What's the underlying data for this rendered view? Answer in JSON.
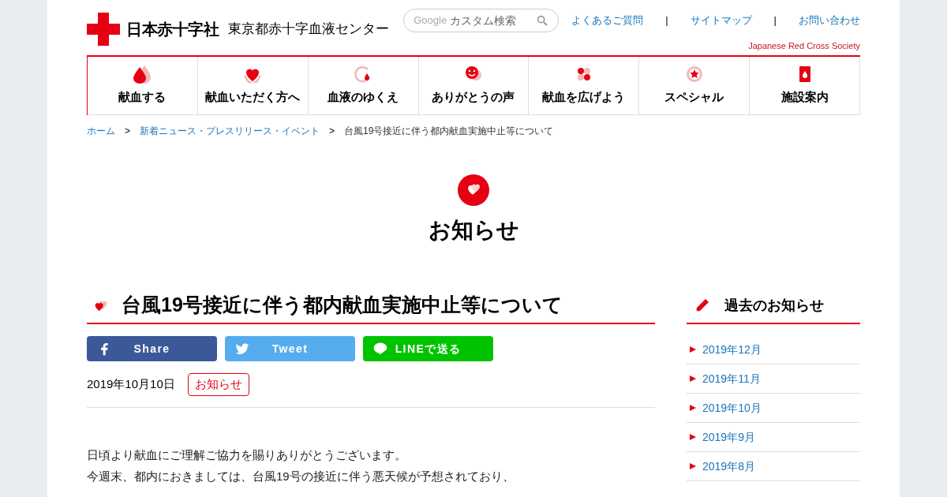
{
  "header": {
    "logo": "日本赤十字社",
    "center_name": "東京都赤十字血液センター",
    "search": {
      "brand": "Google",
      "placeholder": "カスタム検索"
    },
    "links": [
      "よくあるご質問",
      "サイトマップ",
      "お問い合わせ"
    ],
    "separators": [
      "|",
      "|"
    ],
    "tagline": "Japanese Red Cross Society"
  },
  "nav": [
    {
      "label": "献血する"
    },
    {
      "label": "献血いただく方へ"
    },
    {
      "label": "血液のゆくえ"
    },
    {
      "label": "ありがとうの声"
    },
    {
      "label": "献血を広げよう"
    },
    {
      "label": "スペシャル"
    },
    {
      "label": "施設案内"
    }
  ],
  "breadcrumb": [
    {
      "label": "ホーム",
      "kind": "link"
    },
    {
      "label": "新着ニュース・プレスリリース・イベント",
      "kind": "link"
    },
    {
      "label": "台風19号接近に伴う都内献血実施中止等について",
      "kind": "current"
    }
  ],
  "breadcrumb_separators": [
    ">",
    ">"
  ],
  "page_title": "お知らせ",
  "article": {
    "title": "台風19号接近に伴う都内献血実施中止等について",
    "share": [
      {
        "kind": "facebook",
        "label": "Share"
      },
      {
        "kind": "twitter",
        "label": "Tweet"
      },
      {
        "kind": "line",
        "label": "LINEで送る"
      }
    ],
    "date": "2019年10月10日",
    "tag": "お知らせ",
    "paragraphs": [
      "日頃より献血にご理解ご協力を賜りありがとうございます。",
      "今週末、都内におきましては、台風19号の接近に伴う悪天候が予想されており、"
    ]
  },
  "sidebar": {
    "title": "過去のお知らせ",
    "items": [
      "2019年12月",
      "2019年11月",
      "2019年10月",
      "2019年9月",
      "2019年8月"
    ]
  }
}
